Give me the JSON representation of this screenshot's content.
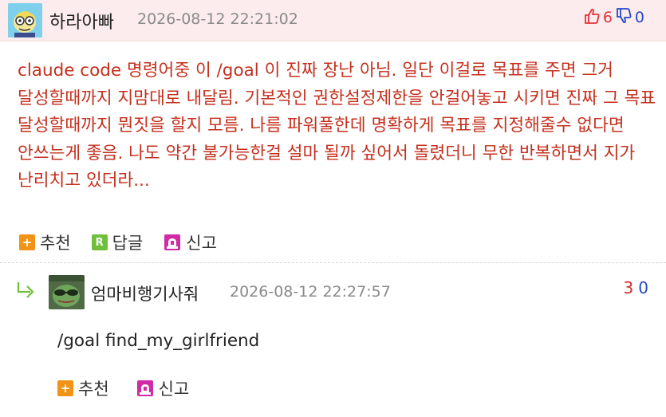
{
  "comment": {
    "nickname": "하라아빠",
    "timestamp": "2026-08-12 22:21:02",
    "upvotes": "6",
    "downvotes": "0",
    "text": "claude code 명령어중 이 /goal 이 진짜 장난 아님. 일단 이걸로 목표를 주면 그거 달성할때까지 지맘대로 내달림. 기본적인 권한설정제한을 안걸어놓고 시키면 진짜 그 목표 달성할때까지 뭔짓을 할지 모름. 나름 파워풀한데 명확하게 목표를 지정해줄수 없다면 안쓰는게 좋음. 나도 약간 불가능한걸 설마 될까 싶어서 돌렸더니 무한 반복하면서 지가 난리치고 있더라...",
    "actions": {
      "recommend": "추천",
      "reply": "답글",
      "report": "신고"
    }
  },
  "reply": {
    "nickname": "엄마비행기사줘",
    "timestamp": "2026-08-12 22:27:57",
    "upvotes": "3",
    "downvotes": "0",
    "text": "/goal find_my_girlfriend",
    "actions": {
      "recommend": "추천",
      "report": "신고"
    }
  },
  "icons": {
    "thumb_up": "thumbs-up-icon",
    "thumb_down": "thumbs-down-icon",
    "recommend": "plus-icon",
    "reply": "reply-r-icon",
    "report": "siren-icon",
    "reply_arrow": "reply-arrow-icon"
  },
  "colors": {
    "header_bg": "#fdeced",
    "comment_text": "#c4301e",
    "upvote": "#e0343a",
    "downvote": "#2348c8",
    "recommend_icon": "#f19317",
    "reply_icon": "#6fbf3a"
  }
}
